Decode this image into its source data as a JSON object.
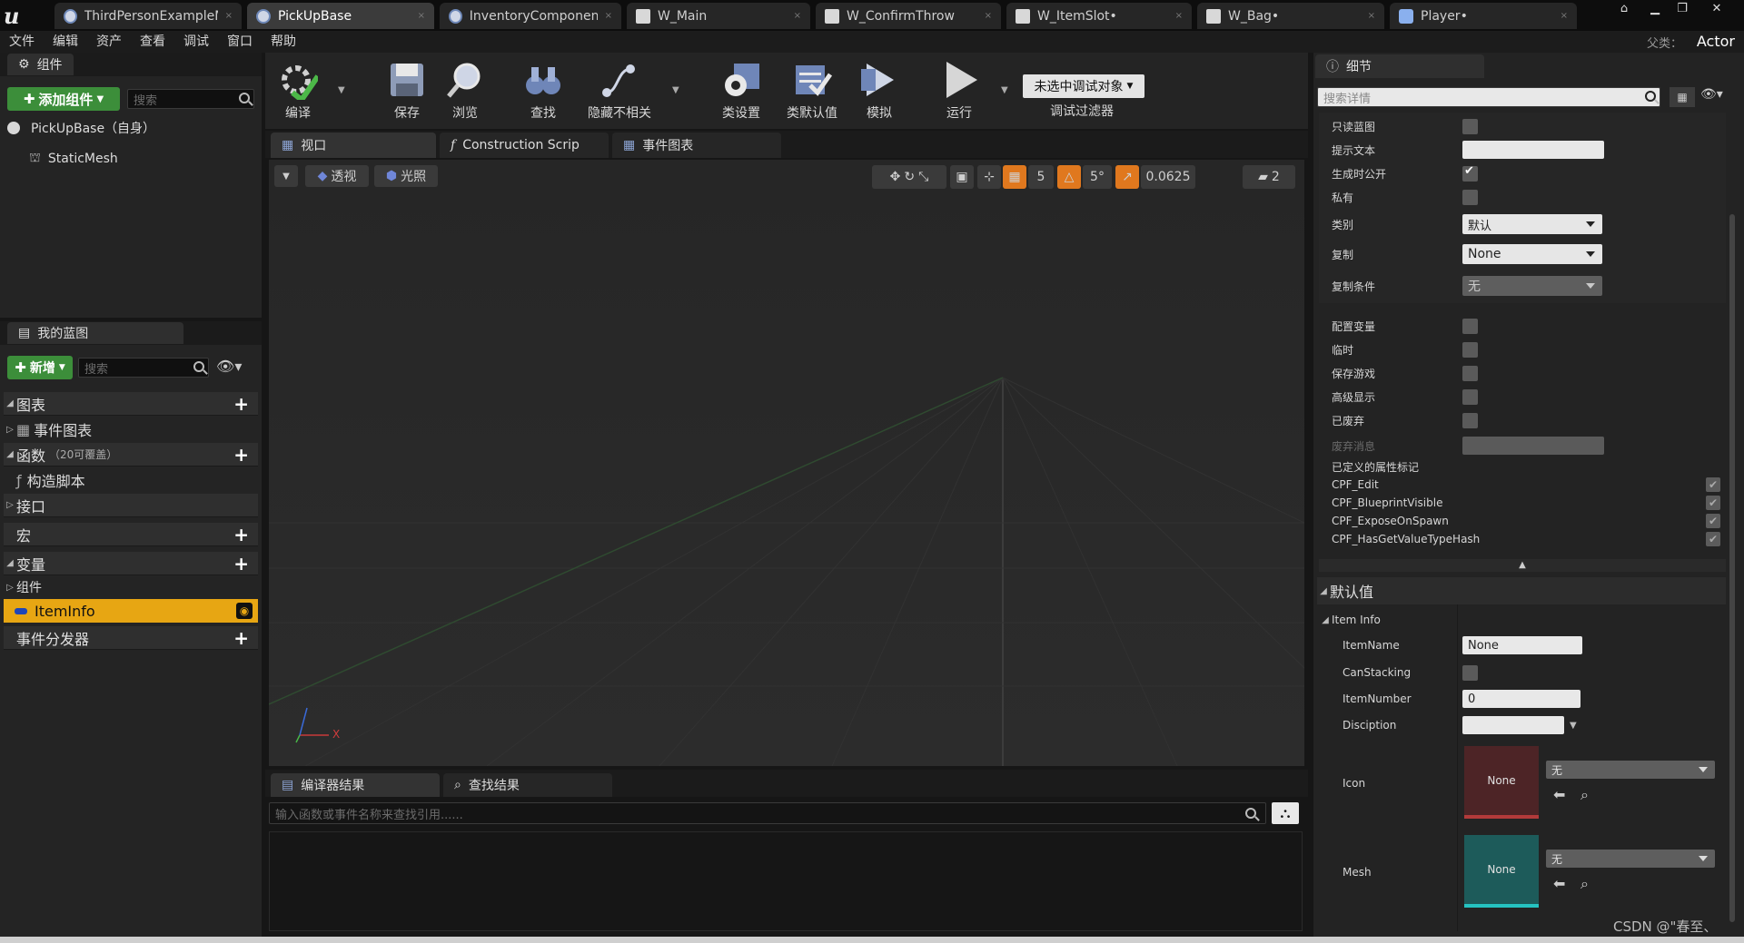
{
  "tabs": [
    {
      "label": "ThirdPersonExampleMa",
      "icon": "third-person-icon",
      "active": false
    },
    {
      "label": "PickUpBase",
      "icon": "blueprint-icon",
      "active": true
    },
    {
      "label": "InventoryComponent•",
      "icon": "blueprint-icon",
      "active": false
    },
    {
      "label": "W_Main",
      "icon": "widget-icon",
      "active": false
    },
    {
      "label": "W_ConfirmThrow",
      "icon": "widget-icon",
      "active": false
    },
    {
      "label": "W_ItemSlot•",
      "icon": "widget-icon",
      "active": false
    },
    {
      "label": "W_Bag•",
      "icon": "widget-icon",
      "active": false
    },
    {
      "label": "Player•",
      "icon": "player-icon",
      "active": false
    }
  ],
  "menu": [
    "文件",
    "编辑",
    "资产",
    "查看",
    "调试",
    "窗口",
    "帮助"
  ],
  "parent": {
    "label": "父类：",
    "value": "Actor"
  },
  "components": {
    "title": "组件",
    "add_label": "添加组件",
    "search_placeholder": "搜索",
    "root": "PickUpBase（自身）",
    "child": "StaticMesh"
  },
  "myblueprint": {
    "title": "我的蓝图",
    "new_label": "新增",
    "search_placeholder": "搜索",
    "graphs": "图表",
    "event_graph": "事件图表",
    "functions": "函数",
    "functions_note": "（20可覆盖）",
    "construction": "构造脚本",
    "interfaces": "接口",
    "macros": "宏",
    "variables": "变量",
    "components_cat": "组件",
    "selected_var": "ItemInfo",
    "dispatchers": "事件分发器"
  },
  "toolbar": {
    "compile": "编译",
    "save": "保存",
    "browse": "浏览",
    "find": "查找",
    "hide": "隐藏不相关",
    "class_settings": "类设置",
    "class_defaults": "类默认值",
    "simulate": "模拟",
    "play": "运行",
    "debug_object": "未选中调试对象",
    "debug_filter": "调试过滤器"
  },
  "editor_tabs": {
    "viewport": "视口",
    "construction": "Construction Scrip",
    "event_graph": "事件图表"
  },
  "viewport": {
    "perspective": "透视",
    "lit": "光照",
    "grid_snap": "5",
    "rot_snap": "5°",
    "scale_snap": "0.0625",
    "camera_speed": "2",
    "axis_x": "X"
  },
  "results": {
    "compiler_tab": "编译器结果",
    "find_tab": "查找结果",
    "search_placeholder": "输入函数或事件名称来查找引用......"
  },
  "details": {
    "title": "细节",
    "search_placeholder": "搜索详情",
    "readonly": "只读蓝图",
    "tooltip": "提示文本",
    "expose_on_spawn": "生成时公开",
    "private": "私有",
    "category": "类别",
    "category_val": "默认",
    "replication": "复制",
    "replication_val": "None",
    "rep_condition": "复制条件",
    "rep_condition_val": "无",
    "config": "配置变量",
    "transient": "临时",
    "savegame": "保存游戏",
    "advanced": "高级显示",
    "deprecated": "已废弃",
    "deprecated_msg": "废弃消息",
    "property_flags": "已定义的属性标记",
    "flags": [
      "CPF_Edit",
      "CPF_BlueprintVisible",
      "CPF_ExposeOnSpawn",
      "CPF_HasGetValueTypeHash"
    ],
    "default_value": "默认值",
    "item_info": "Item Info",
    "item_name_label": "ItemName",
    "item_name_val": "None",
    "can_stacking": "CanStacking",
    "item_number_label": "ItemNumber",
    "item_number_val": "0",
    "discription": "Disciption",
    "icon_label": "Icon",
    "icon_thumb": "None",
    "icon_sel": "无",
    "mesh_label": "Mesh",
    "mesh_thumb": "None",
    "mesh_sel": "无"
  },
  "watermark": "CSDN @\"春至、"
}
